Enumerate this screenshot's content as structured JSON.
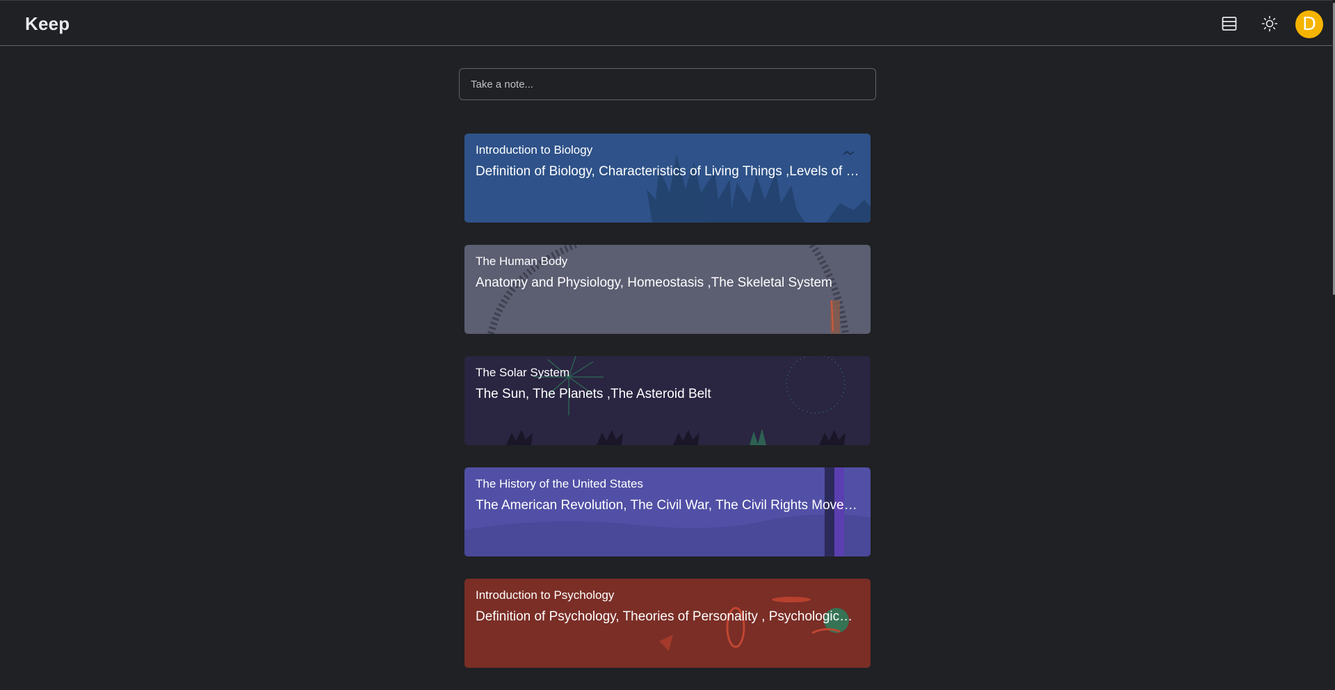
{
  "app": {
    "title": "Keep"
  },
  "header": {
    "layout_icon": "list-layout-icon",
    "theme_icon": "sun-icon",
    "avatar_letter": "D",
    "avatar_color": "#f5b400"
  },
  "composer": {
    "placeholder": "Take a note..."
  },
  "notes": [
    {
      "title": "Introduction to Biology",
      "body": "Definition of Biology, Characteristics of Living Things ,Levels of Biological Organization",
      "color": "#2e5289",
      "theme": "nature"
    },
    {
      "title": "The Human Body",
      "body": "Anatomy and Physiology, Homeostasis ,The Skeletal System",
      "color": "#5c5e72",
      "theme": "rails"
    },
    {
      "title": "The Solar System",
      "body": "The Sun, The Planets ,The Asteroid Belt",
      "color": "#2a2541",
      "theme": "night"
    },
    {
      "title": "The History of the United States",
      "body": "The American Revolution, The Civil War, The Civil Rights Movement",
      "color": "#5150a6",
      "theme": "landscape"
    },
    {
      "title": "Introduction to Psychology",
      "body": "Definition of Psychology, Theories of Personality , Psychological Disorders",
      "color": "#7a2e26",
      "theme": "space"
    }
  ]
}
